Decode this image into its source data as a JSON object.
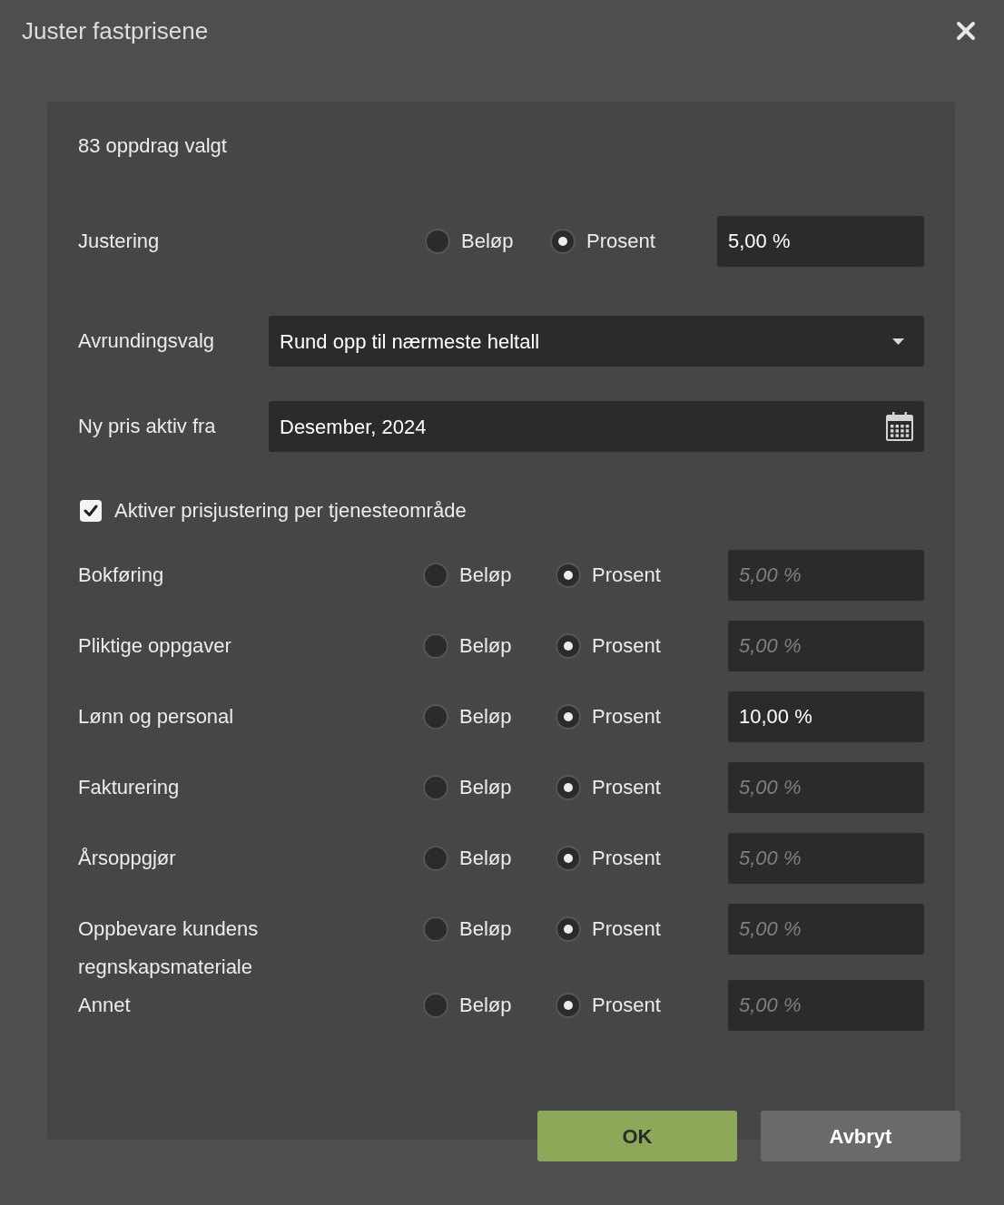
{
  "dialog": {
    "title": "Juster fastprisene"
  },
  "summary": "83 oppdrag valgt",
  "adjustment": {
    "label": "Justering",
    "options": [
      {
        "label": "Beløp",
        "selected": false
      },
      {
        "label": "Prosent",
        "selected": true
      }
    ],
    "value": "5,00 %"
  },
  "rounding": {
    "label": "Avrundingsvalg",
    "value": "Rund opp til nærmeste heltall"
  },
  "active_from": {
    "label": "Ny pris aktiv fra",
    "value": "Desember, 2024"
  },
  "per_area": {
    "label": "Aktiver prisjustering per tjenesteområde",
    "checked": true
  },
  "areas": [
    {
      "name": "Bokføring",
      "options": [
        {
          "label": "Beløp",
          "selected": false
        },
        {
          "label": "Prosent",
          "selected": true
        }
      ],
      "placeholder": "5,00 %"
    },
    {
      "name": "Pliktige oppgaver",
      "options": [
        {
          "label": "Beløp",
          "selected": false
        },
        {
          "label": "Prosent",
          "selected": true
        }
      ],
      "placeholder": "5,00 %"
    },
    {
      "name": "Lønn og personal",
      "options": [
        {
          "label": "Beløp",
          "selected": false
        },
        {
          "label": "Prosent",
          "selected": true
        }
      ],
      "value": "10,00 %"
    },
    {
      "name": "Fakturering",
      "options": [
        {
          "label": "Beløp",
          "selected": false
        },
        {
          "label": "Prosent",
          "selected": true
        }
      ],
      "placeholder": "5,00 %"
    },
    {
      "name": "Årsoppgjør",
      "options": [
        {
          "label": "Beløp",
          "selected": false
        },
        {
          "label": "Prosent",
          "selected": true
        }
      ],
      "placeholder": "5,00 %"
    },
    {
      "name": "Oppbevare kundens regnskapsmateriale",
      "options": [
        {
          "label": "Beløp",
          "selected": false
        },
        {
          "label": "Prosent",
          "selected": true
        }
      ],
      "placeholder": "5,00 %"
    },
    {
      "name": "Annet",
      "options": [
        {
          "label": "Beløp",
          "selected": false
        },
        {
          "label": "Prosent",
          "selected": true
        }
      ],
      "placeholder": "5,00 %"
    }
  ],
  "buttons": [
    {
      "label": "OK",
      "kind": "primary"
    },
    {
      "label": "Avbryt",
      "kind": "secondary"
    }
  ]
}
